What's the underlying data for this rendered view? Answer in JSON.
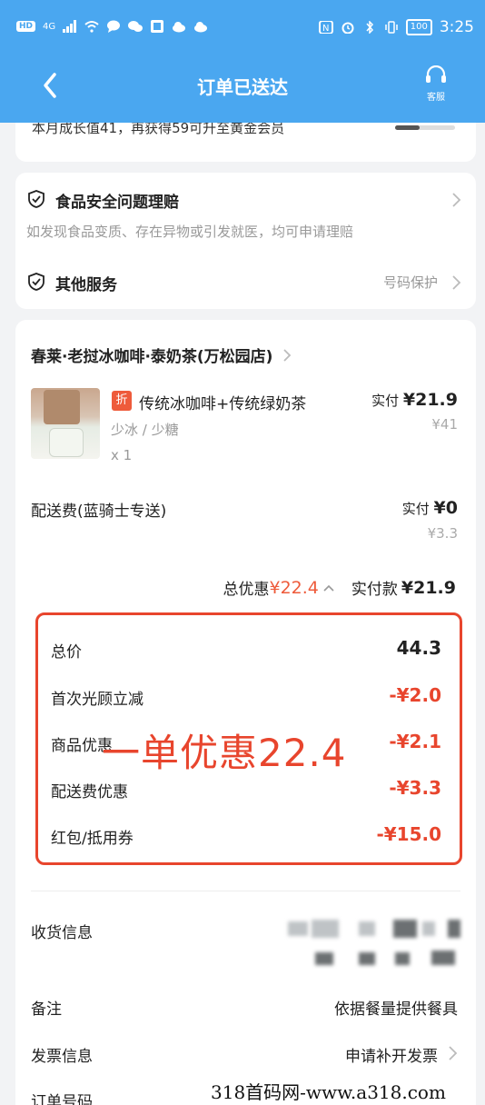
{
  "status_bar": {
    "hd_label": "HD",
    "network_label": "4G",
    "battery_label": "100",
    "time": "3:25"
  },
  "header": {
    "title": "订单已送达",
    "service_label": "客服"
  },
  "membership": {
    "growth_text": "本月成长值41，再获得59可升至黄金会员",
    "progress": 0.41
  },
  "services": {
    "food_safety_title": "食品安全问题理赔",
    "food_safety_desc": "如发现食品变质、存在异物或引发就医，均可申请理赔",
    "other_title": "其他服务",
    "other_value": "号码保护"
  },
  "order": {
    "store_name": "春莱·老挝冰咖啡·泰奶茶(万松园店)",
    "item": {
      "badge": "折",
      "name": "传统冰咖啡+传统绿奶茶",
      "spec": "少冰 / 少糖",
      "qty": "x 1",
      "paid_label": "实付",
      "paid_price": "¥21.9",
      "original_price": "¥41"
    },
    "delivery": {
      "label": "配送费(蓝骑士专送)",
      "paid_label": "实付",
      "paid_price": "¥0",
      "original_price": "¥3.3"
    },
    "totals": {
      "discount_label": "总优惠",
      "discount_value": "¥22.4",
      "paid_label": "实付款",
      "paid_value": "¥21.9"
    },
    "breakdown": [
      {
        "label": "总价",
        "value": "44.3",
        "red": false
      },
      {
        "label": "首次光顾立减",
        "value": "-¥2.0",
        "red": true
      },
      {
        "label": "商品优惠",
        "value": "-¥2.1",
        "red": true
      },
      {
        "label": "配送费优惠",
        "value": "-¥3.3",
        "red": true
      },
      {
        "label": "红包/抵用券",
        "value": "-¥15.0",
        "red": true
      }
    ],
    "overlay_text": "一单优惠22.4"
  },
  "info": {
    "receiver_label": "收货信息",
    "note_label": "备注",
    "note_value": "依据餐量提供餐具",
    "invoice_label": "发票信息",
    "invoice_value": "申请补开发票",
    "order_no_label": "订单号码"
  },
  "watermark": "318首码网-www.a318.com",
  "colors": {
    "header_blue": "#4aa7f0",
    "accent_red": "#e8452d",
    "badge_red": "#ee5b3b"
  }
}
